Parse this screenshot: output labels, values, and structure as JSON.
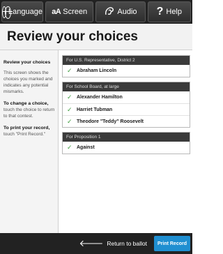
{
  "toolbar": {
    "language_label": "Language",
    "screen_icon_text": "aA",
    "screen_label": "Screen",
    "audio_label": "Audio",
    "help_label": "Help"
  },
  "page": {
    "title": "Review your choices"
  },
  "sidebar": {
    "heading": "Review your choices",
    "description": "This screen shows the choices you marked and indicates any potential mismarks.",
    "change_heading": "To change a choice,",
    "change_text": "touch the choice to return to that contest.",
    "print_heading": "To print your record,",
    "print_text": "touch \"Print Record.\""
  },
  "contests": [
    {
      "header": "For U.S. Representative, District 2",
      "choices": [
        "Abraham Lincoln"
      ]
    },
    {
      "header": "For School Board, at large",
      "choices": [
        "Alexander Hamilton",
        "Harriet Tubman",
        "Theodore \"Teddy\" Roosevelt"
      ]
    },
    {
      "header": "For Proposition 1",
      "choices": [
        "Against"
      ]
    }
  ],
  "bottom": {
    "return_label": "Return to ballot",
    "print_label": "Print Record"
  },
  "colors": {
    "accent": "#1f8fd1",
    "check": "#3a9a3a",
    "bar": "#222222"
  }
}
